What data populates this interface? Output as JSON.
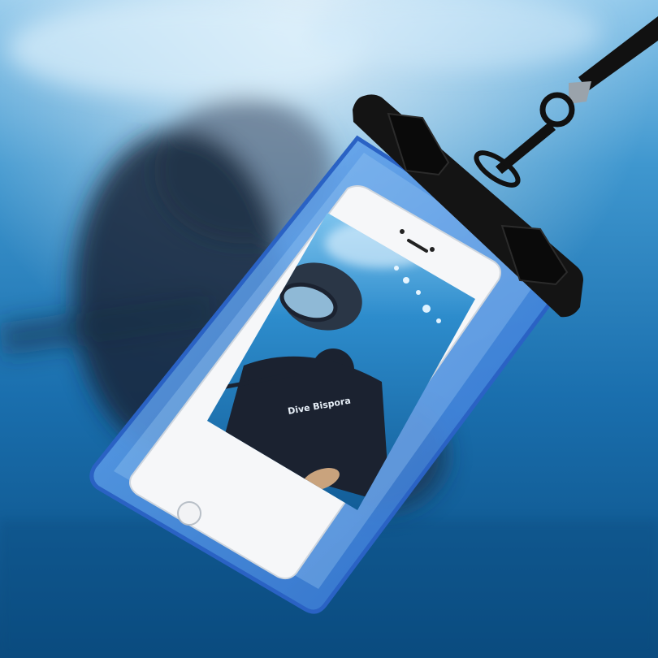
{
  "scene": {
    "subject": "waterproof-phone-pouch-underwater",
    "colors": {
      "water_light": "#6fb6e0",
      "water_mid": "#1f7ab8",
      "water_deep": "#0c4f82",
      "pouch_blue": "#4a8fe0",
      "pouch_edge": "#2f6fd0",
      "clip_black": "#141414",
      "phone_white": "#f6f7f9",
      "screen_water": "#2a86c8",
      "diver_dark": "#1b2230"
    }
  },
  "phone_screen": {
    "printed_text": "Dive Bispora"
  }
}
